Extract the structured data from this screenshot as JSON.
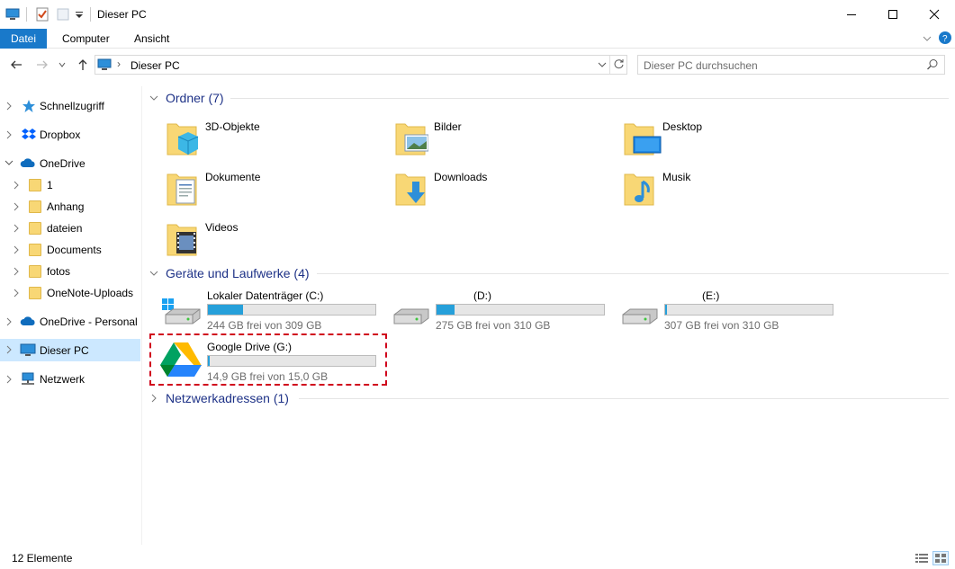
{
  "window": {
    "title": "Dieser PC"
  },
  "ribbon": {
    "tabs": [
      "Datei",
      "Computer",
      "Ansicht"
    ]
  },
  "address": {
    "current": "Dieser PC",
    "search_placeholder": "Dieser PC durchsuchen"
  },
  "sidebar": {
    "items": [
      {
        "label": "Schnellzugriff"
      },
      {
        "label": "Dropbox"
      },
      {
        "label": "OneDrive"
      },
      {
        "label": "1"
      },
      {
        "label": "Anhang"
      },
      {
        "label": "dateien"
      },
      {
        "label": "Documents"
      },
      {
        "label": "fotos"
      },
      {
        "label": "OneNote-Uploads"
      },
      {
        "label": "OneDrive - Personal"
      },
      {
        "label": "Dieser PC"
      },
      {
        "label": "Netzwerk"
      }
    ]
  },
  "groups": {
    "folders": {
      "title": "Ordner (7)"
    },
    "drives": {
      "title": "Geräte und Laufwerke (4)"
    },
    "network": {
      "title": "Netzwerkadressen (1)"
    }
  },
  "folders": [
    {
      "label": "3D-Objekte"
    },
    {
      "label": "Bilder"
    },
    {
      "label": "Desktop"
    },
    {
      "label": "Dokumente"
    },
    {
      "label": "Downloads"
    },
    {
      "label": "Musik"
    },
    {
      "label": "Videos"
    }
  ],
  "drives": [
    {
      "label": "Lokaler Datenträger (C:)",
      "free": "244 GB frei von 309 GB",
      "used_fraction": 0.21
    },
    {
      "label": "(D:)",
      "free": "275 GB frei von 310 GB",
      "used_fraction": 0.11
    },
    {
      "label": "(E:)",
      "free": "307 GB frei von 310 GB",
      "used_fraction": 0.01
    },
    {
      "label": "Google Drive (G:)",
      "free": "14,9 GB frei von 15,0 GB",
      "used_fraction": 0.01
    }
  ],
  "status": {
    "count": "12 Elemente"
  },
  "colors": {
    "accent": "#1979ca",
    "group_header": "#1e3287",
    "drive_fill": "#26a0da",
    "highlight": "#d0021b",
    "selected": "#cce8ff"
  }
}
